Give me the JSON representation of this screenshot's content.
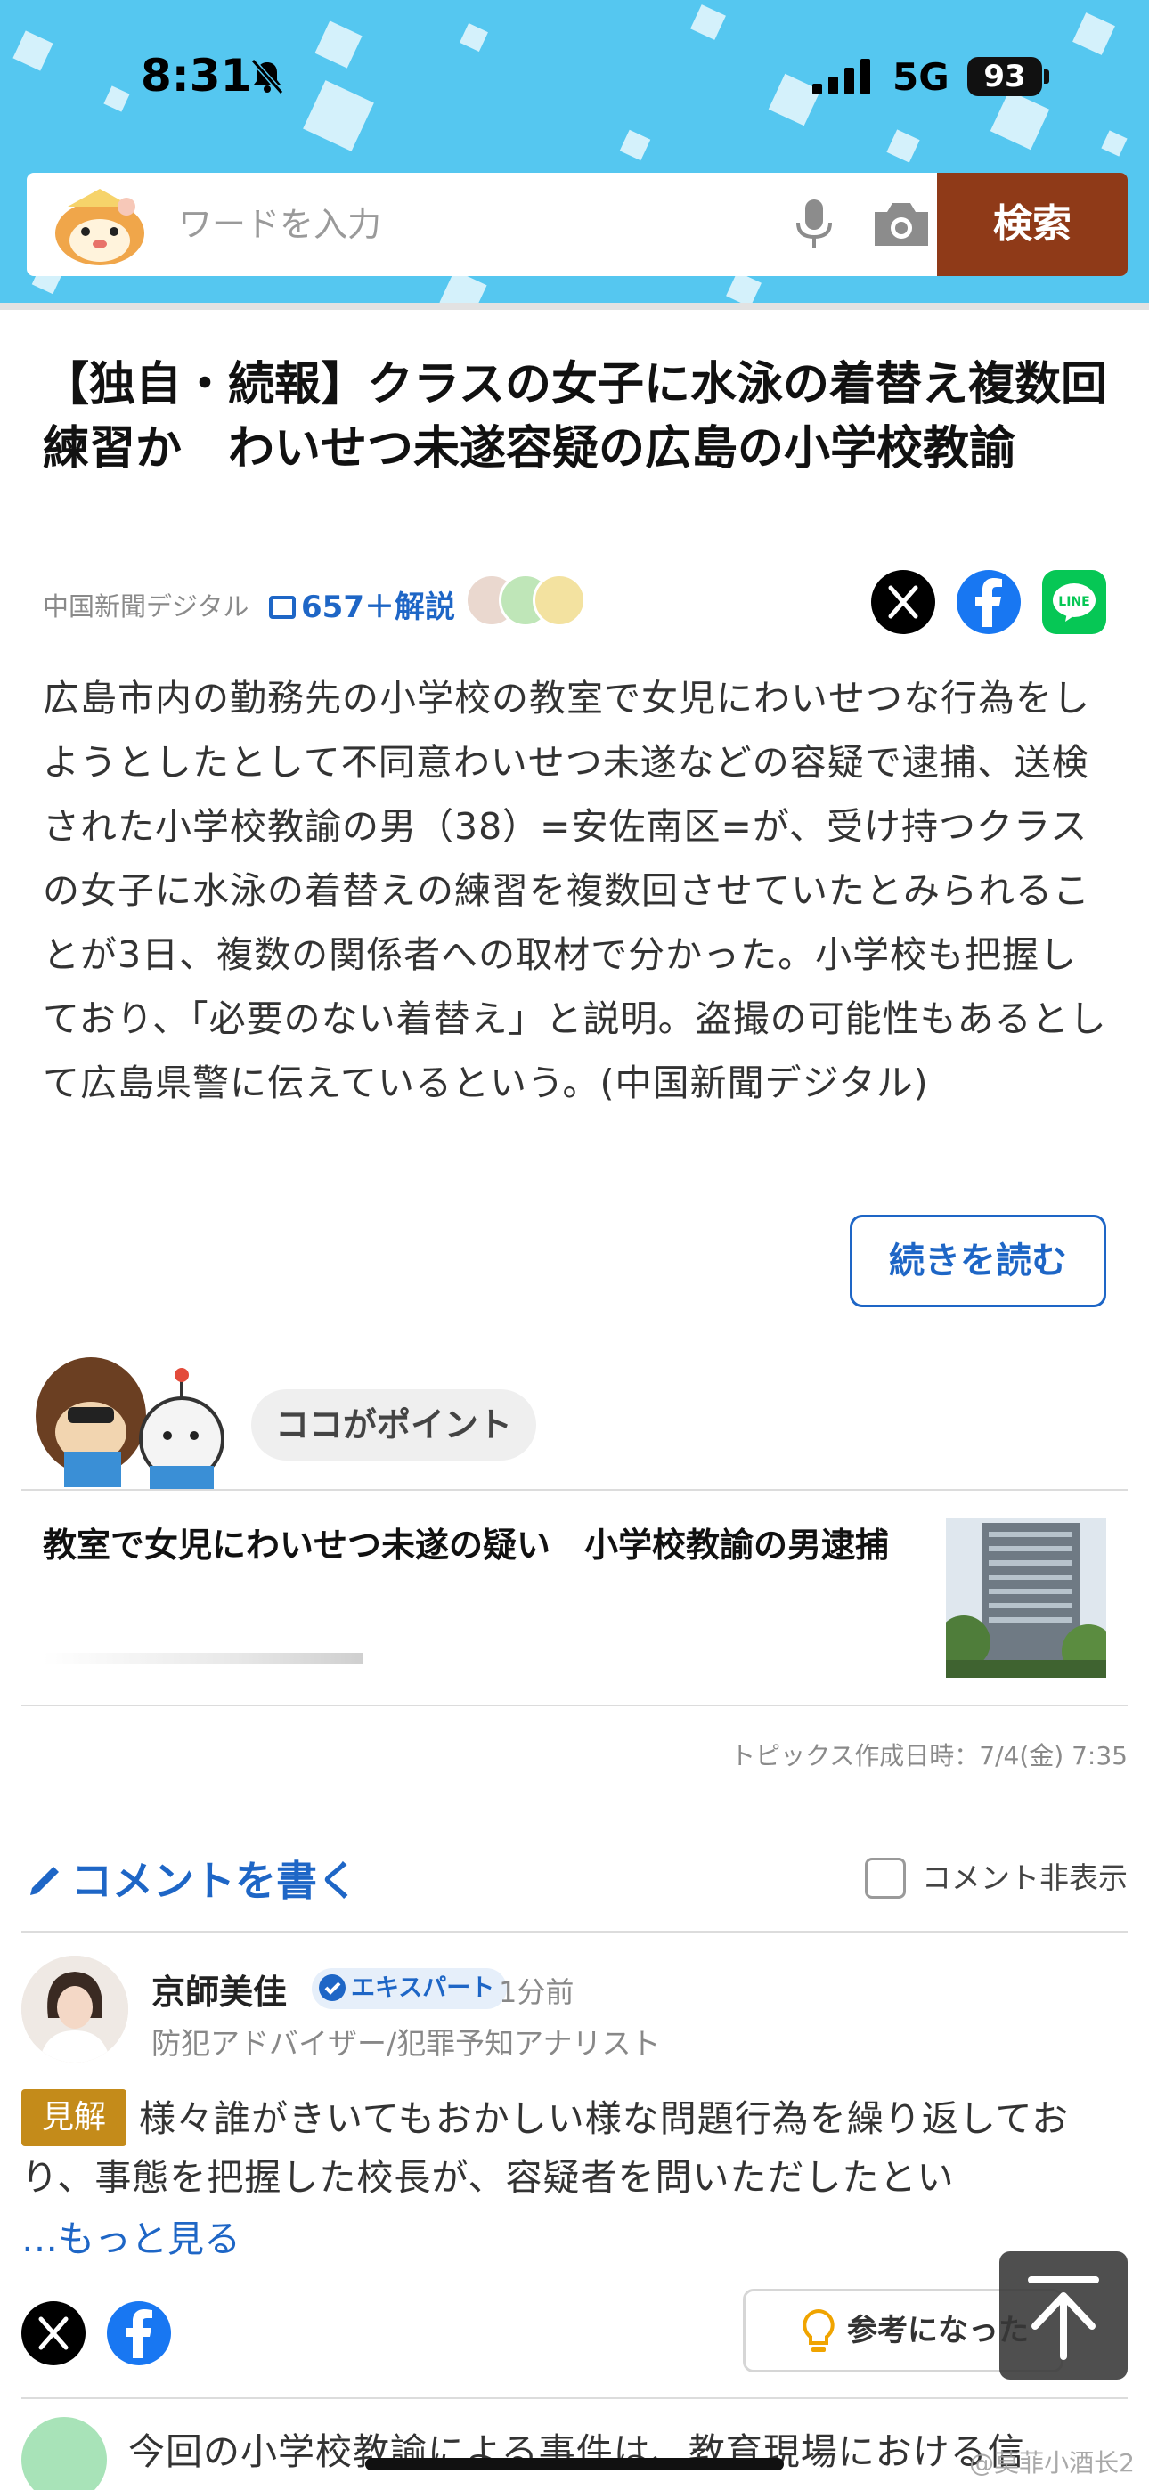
{
  "status_bar": {
    "time": "8:31",
    "network": "5G",
    "battery": "93"
  },
  "search": {
    "placeholder": "ワードを入力",
    "button_label": "検索"
  },
  "article": {
    "headline": "【独自・続報】クラスの女子に水泳の着替え複数回練習か　わいせつ未遂容疑の広島の小学校教諭",
    "source": "中国新聞デジタル",
    "comment_count_label": "657＋解説",
    "body": "広島市内の勤務先の小学校の教室で女児にわいせつな行為をしようとしたとして不同意わいせつ未遂などの容疑で逮捕、送検された小学校教諭の男（38）=安佐南区=が、受け持つクラスの女子に水泳の着替えの練習を複数回させていたとみられることが3日、複数の関係者への取材で分かった。小学校も把握しており、「必要のない着替え」と説明。盗撮の可能性もあるとして広島県警に伝えているという。(中国新聞デジタル)",
    "read_more_label": "続きを読む"
  },
  "point": {
    "label": "ココがポイント",
    "topic_title": "教室で女児にわいせつ未遂の疑い　小学校教諭の男逮捕",
    "topics_date": "トピックス作成日時：7/4(金) 7:35"
  },
  "comments": {
    "write_label": "コメントを書く",
    "hide_label": "コメント非表示",
    "first": {
      "author": "京師美佳",
      "badge": "エキスパート",
      "time": "1分前",
      "role": "防犯アドバイザー/犯罪予知アナリスト",
      "tag": "見解",
      "text": "様々誰がきいてもおかしい様な問題行為を繰り返しており、事態を把握した校長が、容疑者を問いただしたとい",
      "more_label": "…もっと見る",
      "helpful_label": "参考になった"
    },
    "next_text": "今回の小学校教諭による事件は、教育現場における信"
  },
  "watermark": "@莫菲小酒长2",
  "colors": {
    "header_bg": "#55c7f0",
    "search_button": "#8f3a18",
    "link_blue": "#1e66c6",
    "tag_gold": "#c48b1a"
  }
}
